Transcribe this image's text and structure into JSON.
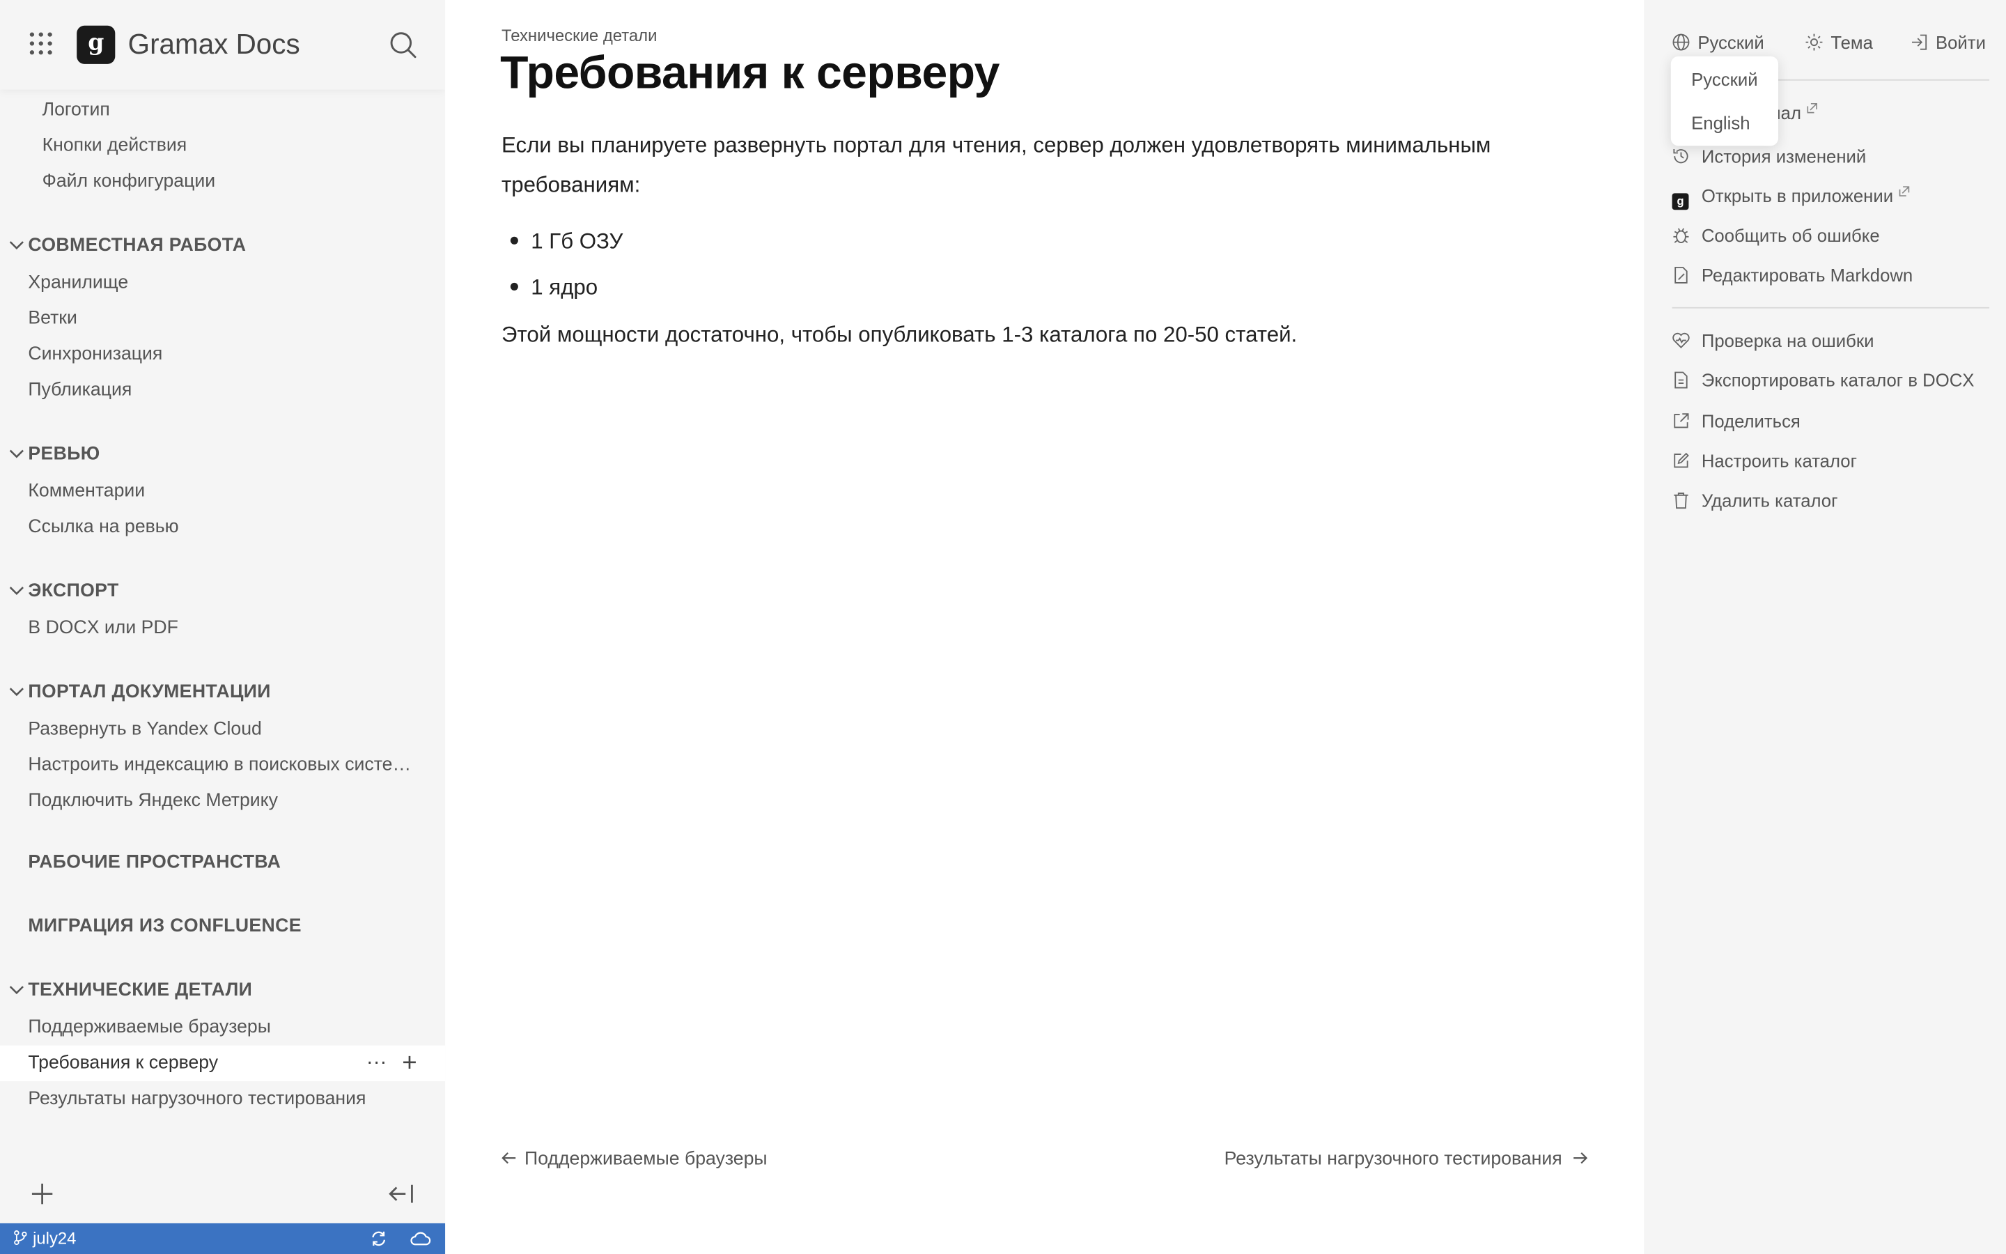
{
  "header": {
    "app_title": "Gramax Docs",
    "logo_letter": "g"
  },
  "nav": {
    "top_items": [
      "Логотип",
      "Кнопки действия",
      "Файл конфигурации"
    ],
    "sections": [
      {
        "title": "СОВМЕСТНАЯ РАБОТА",
        "items": [
          "Хранилище",
          "Ветки",
          "Синхронизация",
          "Публикация"
        ]
      },
      {
        "title": "РЕВЬЮ",
        "items": [
          "Комментарии",
          "Ссылка на ревью"
        ]
      },
      {
        "title": "ЭКСПОРТ",
        "items": [
          "В DOCX или PDF"
        ]
      },
      {
        "title": "ПОРТАЛ ДОКУМЕНТАЦИИ",
        "items": [
          "Развернуть в Yandex Cloud",
          "Настроить индексацию в поисковых системах",
          "Подключить Яндекс Метрику"
        ]
      },
      {
        "title": "РАБОЧИЕ ПРОСТРАНСТВА",
        "items": []
      },
      {
        "title": "МИГРАЦИЯ ИЗ CONFLUENCE",
        "items": []
      },
      {
        "title": "ТЕХНИЧЕСКИЕ ДЕТАЛИ",
        "items": [
          "Поддерживаемые браузеры",
          "Требования к серверу",
          "Результаты нагрузочного тестирования"
        ]
      }
    ],
    "active_item": "Требования к серверу",
    "row_more": "···",
    "row_add": "+"
  },
  "status": {
    "branch": "july24",
    "accent_color": "#3b73c2"
  },
  "article": {
    "breadcrumb": "Технические детали",
    "title": "Требования к серверу",
    "intro": "Если вы планируете развернуть портал для чтения, сервер должен удовлетворять минимальным требованиям:",
    "bullets": [
      "1 Гб ОЗУ",
      "1 ядро"
    ],
    "outro": "Этой мощности достаточно, чтобы опубликовать 1-3 каталога по 20-50 статей.",
    "prev": "Поддерживаемые браузеры",
    "next": "Результаты нагрузочного тестирования"
  },
  "right_panel": {
    "language": "Русский",
    "theme": "Тема",
    "login": "Войти",
    "actions_group1": [
      {
        "label": "Telegram-канал",
        "icon": "telegram-icon",
        "external": true,
        "visible_label": "канал"
      },
      {
        "label": "История изменений",
        "icon": "history-icon",
        "external": false
      },
      {
        "label": "Открыть в приложении",
        "icon": "gramax-app-icon",
        "external": true
      },
      {
        "label": "Сообщить об ошибке",
        "icon": "bug-icon",
        "external": false
      },
      {
        "label": "Редактировать Markdown",
        "icon": "markdown-edit-icon",
        "external": false
      }
    ],
    "actions_group2": [
      {
        "label": "Проверка на ошибки",
        "icon": "health-check-icon"
      },
      {
        "label": "Экспортировать каталог в DOCX",
        "icon": "file-export-icon"
      },
      {
        "label": "Поделиться",
        "icon": "share-icon"
      },
      {
        "label": "Настроить каталог",
        "icon": "edit-icon"
      },
      {
        "label": "Удалить каталог",
        "icon": "trash-icon"
      }
    ]
  },
  "lang_dropdown": {
    "options": [
      "Русский",
      "English"
    ]
  }
}
